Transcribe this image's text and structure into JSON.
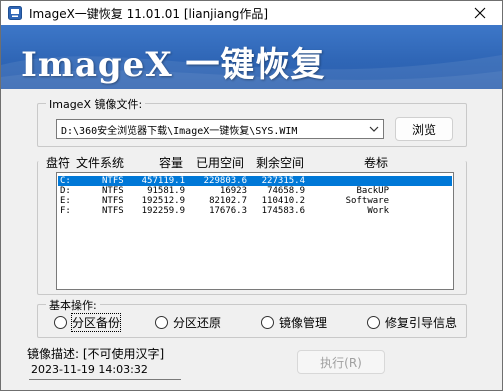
{
  "window": {
    "title": "ImageX一键恢复 11.01.01 [lianjiang作品]",
    "close_icon": "close-icon",
    "app_icon": "imagex-app-icon"
  },
  "banner": {
    "title": "ImageX 一键恢复"
  },
  "image_file": {
    "legend": "ImageX 镜像文件:",
    "selected_path": "D:\\360安全浏览器下载\\ImageX一键恢复\\SYS.WIM",
    "browse_label": "浏览"
  },
  "partitions": {
    "headers": {
      "drive": "盘符",
      "fs": "文件系统",
      "capacity": "容量",
      "used": "已用空间",
      "free": "剩余空间",
      "label": "卷标"
    },
    "rows": [
      {
        "drive": "C:",
        "fs": "NTFS",
        "capacity": "457119.1",
        "used": "229803.6",
        "free": "227315.4",
        "label": "",
        "selected": true
      },
      {
        "drive": "D:",
        "fs": "NTFS",
        "capacity": "91581.9",
        "used": "16923",
        "free": "74658.9",
        "label": "BackUP",
        "selected": false
      },
      {
        "drive": "E:",
        "fs": "NTFS",
        "capacity": "192512.9",
        "used": "82102.7",
        "free": "110410.2",
        "label": "Software",
        "selected": false
      },
      {
        "drive": "F:",
        "fs": "NTFS",
        "capacity": "192259.9",
        "used": "17676.3",
        "free": "174583.6",
        "label": "Work",
        "selected": false
      }
    ]
  },
  "operations": {
    "legend": "基本操作:",
    "options": [
      {
        "label": "分区备份",
        "checked": false,
        "focused": true
      },
      {
        "label": "分区还原",
        "checked": false,
        "focused": false
      },
      {
        "label": "镜像管理",
        "checked": false,
        "focused": false
      },
      {
        "label": "修复引导信息",
        "checked": false,
        "focused": false
      }
    ]
  },
  "footer": {
    "desc_label": "镜像描述: [不可使用汉字]",
    "desc_value": "2023-11-19 14:03:32",
    "execute_label": "执行(R)",
    "execute_enabled": false
  },
  "colors": {
    "banner": "#2f66b6",
    "selection": "#0078d7",
    "window_bg": "#f0f0f0"
  }
}
